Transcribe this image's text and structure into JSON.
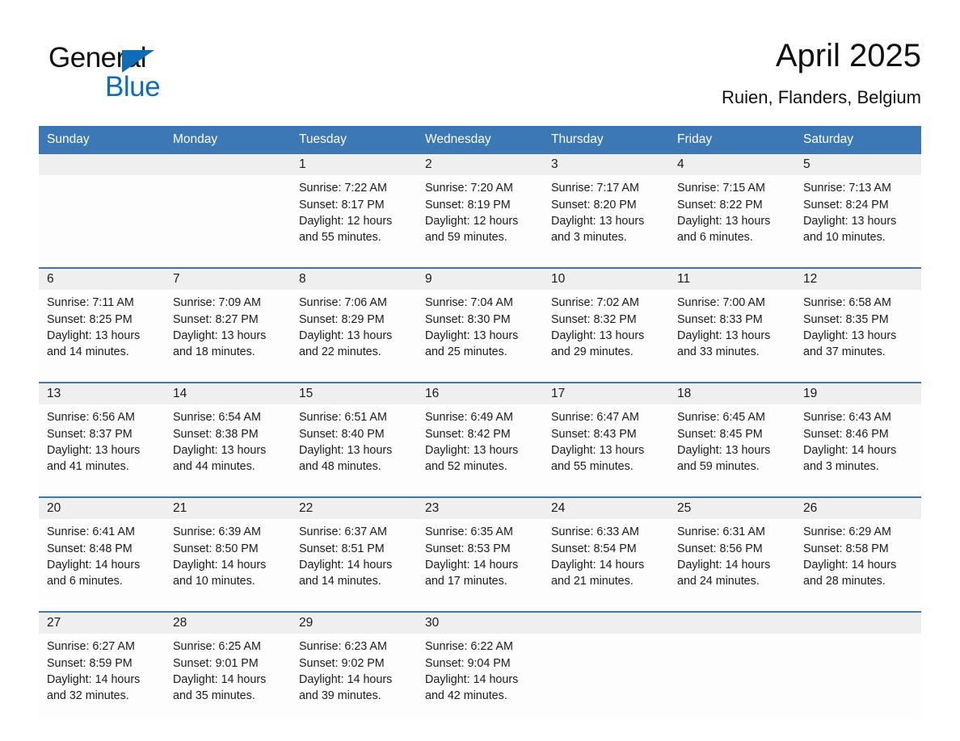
{
  "brand": {
    "name_top": "General",
    "name_bottom": "Blue",
    "triangle_icon": "brand-triangle-icon",
    "accent_color": "#0f6cb6"
  },
  "header": {
    "title": "April 2025",
    "subtitle": "Ruien, Flanders, Belgium"
  },
  "theme": {
    "header_blue": "#3c78b4",
    "date_band_gray": "#efefef",
    "cell_white": "#fdfdfd"
  },
  "weekday_headers": [
    "Sunday",
    "Monday",
    "Tuesday",
    "Wednesday",
    "Thursday",
    "Friday",
    "Saturday"
  ],
  "weeks": [
    [
      {
        "day": "",
        "sunrise": "",
        "sunset": "",
        "daylight_1": "",
        "daylight_2": ""
      },
      {
        "day": "",
        "sunrise": "",
        "sunset": "",
        "daylight_1": "",
        "daylight_2": ""
      },
      {
        "day": "1",
        "sunrise": "Sunrise: 7:22 AM",
        "sunset": "Sunset: 8:17 PM",
        "daylight_1": "Daylight: 12 hours",
        "daylight_2": "and 55 minutes."
      },
      {
        "day": "2",
        "sunrise": "Sunrise: 7:20 AM",
        "sunset": "Sunset: 8:19 PM",
        "daylight_1": "Daylight: 12 hours",
        "daylight_2": "and 59 minutes."
      },
      {
        "day": "3",
        "sunrise": "Sunrise: 7:17 AM",
        "sunset": "Sunset: 8:20 PM",
        "daylight_1": "Daylight: 13 hours",
        "daylight_2": "and 3 minutes."
      },
      {
        "day": "4",
        "sunrise": "Sunrise: 7:15 AM",
        "sunset": "Sunset: 8:22 PM",
        "daylight_1": "Daylight: 13 hours",
        "daylight_2": "and 6 minutes."
      },
      {
        "day": "5",
        "sunrise": "Sunrise: 7:13 AM",
        "sunset": "Sunset: 8:24 PM",
        "daylight_1": "Daylight: 13 hours",
        "daylight_2": "and 10 minutes."
      }
    ],
    [
      {
        "day": "6",
        "sunrise": "Sunrise: 7:11 AM",
        "sunset": "Sunset: 8:25 PM",
        "daylight_1": "Daylight: 13 hours",
        "daylight_2": "and 14 minutes."
      },
      {
        "day": "7",
        "sunrise": "Sunrise: 7:09 AM",
        "sunset": "Sunset: 8:27 PM",
        "daylight_1": "Daylight: 13 hours",
        "daylight_2": "and 18 minutes."
      },
      {
        "day": "8",
        "sunrise": "Sunrise: 7:06 AM",
        "sunset": "Sunset: 8:29 PM",
        "daylight_1": "Daylight: 13 hours",
        "daylight_2": "and 22 minutes."
      },
      {
        "day": "9",
        "sunrise": "Sunrise: 7:04 AM",
        "sunset": "Sunset: 8:30 PM",
        "daylight_1": "Daylight: 13 hours",
        "daylight_2": "and 25 minutes."
      },
      {
        "day": "10",
        "sunrise": "Sunrise: 7:02 AM",
        "sunset": "Sunset: 8:32 PM",
        "daylight_1": "Daylight: 13 hours",
        "daylight_2": "and 29 minutes."
      },
      {
        "day": "11",
        "sunrise": "Sunrise: 7:00 AM",
        "sunset": "Sunset: 8:33 PM",
        "daylight_1": "Daylight: 13 hours",
        "daylight_2": "and 33 minutes."
      },
      {
        "day": "12",
        "sunrise": "Sunrise: 6:58 AM",
        "sunset": "Sunset: 8:35 PM",
        "daylight_1": "Daylight: 13 hours",
        "daylight_2": "and 37 minutes."
      }
    ],
    [
      {
        "day": "13",
        "sunrise": "Sunrise: 6:56 AM",
        "sunset": "Sunset: 8:37 PM",
        "daylight_1": "Daylight: 13 hours",
        "daylight_2": "and 41 minutes."
      },
      {
        "day": "14",
        "sunrise": "Sunrise: 6:54 AM",
        "sunset": "Sunset: 8:38 PM",
        "daylight_1": "Daylight: 13 hours",
        "daylight_2": "and 44 minutes."
      },
      {
        "day": "15",
        "sunrise": "Sunrise: 6:51 AM",
        "sunset": "Sunset: 8:40 PM",
        "daylight_1": "Daylight: 13 hours",
        "daylight_2": "and 48 minutes."
      },
      {
        "day": "16",
        "sunrise": "Sunrise: 6:49 AM",
        "sunset": "Sunset: 8:42 PM",
        "daylight_1": "Daylight: 13 hours",
        "daylight_2": "and 52 minutes."
      },
      {
        "day": "17",
        "sunrise": "Sunrise: 6:47 AM",
        "sunset": "Sunset: 8:43 PM",
        "daylight_1": "Daylight: 13 hours",
        "daylight_2": "and 55 minutes."
      },
      {
        "day": "18",
        "sunrise": "Sunrise: 6:45 AM",
        "sunset": "Sunset: 8:45 PM",
        "daylight_1": "Daylight: 13 hours",
        "daylight_2": "and 59 minutes."
      },
      {
        "day": "19",
        "sunrise": "Sunrise: 6:43 AM",
        "sunset": "Sunset: 8:46 PM",
        "daylight_1": "Daylight: 14 hours",
        "daylight_2": "and 3 minutes."
      }
    ],
    [
      {
        "day": "20",
        "sunrise": "Sunrise: 6:41 AM",
        "sunset": "Sunset: 8:48 PM",
        "daylight_1": "Daylight: 14 hours",
        "daylight_2": "and 6 minutes."
      },
      {
        "day": "21",
        "sunrise": "Sunrise: 6:39 AM",
        "sunset": "Sunset: 8:50 PM",
        "daylight_1": "Daylight: 14 hours",
        "daylight_2": "and 10 minutes."
      },
      {
        "day": "22",
        "sunrise": "Sunrise: 6:37 AM",
        "sunset": "Sunset: 8:51 PM",
        "daylight_1": "Daylight: 14 hours",
        "daylight_2": "and 14 minutes."
      },
      {
        "day": "23",
        "sunrise": "Sunrise: 6:35 AM",
        "sunset": "Sunset: 8:53 PM",
        "daylight_1": "Daylight: 14 hours",
        "daylight_2": "and 17 minutes."
      },
      {
        "day": "24",
        "sunrise": "Sunrise: 6:33 AM",
        "sunset": "Sunset: 8:54 PM",
        "daylight_1": "Daylight: 14 hours",
        "daylight_2": "and 21 minutes."
      },
      {
        "day": "25",
        "sunrise": "Sunrise: 6:31 AM",
        "sunset": "Sunset: 8:56 PM",
        "daylight_1": "Daylight: 14 hours",
        "daylight_2": "and 24 minutes."
      },
      {
        "day": "26",
        "sunrise": "Sunrise: 6:29 AM",
        "sunset": "Sunset: 8:58 PM",
        "daylight_1": "Daylight: 14 hours",
        "daylight_2": "and 28 minutes."
      }
    ],
    [
      {
        "day": "27",
        "sunrise": "Sunrise: 6:27 AM",
        "sunset": "Sunset: 8:59 PM",
        "daylight_1": "Daylight: 14 hours",
        "daylight_2": "and 32 minutes."
      },
      {
        "day": "28",
        "sunrise": "Sunrise: 6:25 AM",
        "sunset": "Sunset: 9:01 PM",
        "daylight_1": "Daylight: 14 hours",
        "daylight_2": "and 35 minutes."
      },
      {
        "day": "29",
        "sunrise": "Sunrise: 6:23 AM",
        "sunset": "Sunset: 9:02 PM",
        "daylight_1": "Daylight: 14 hours",
        "daylight_2": "and 39 minutes."
      },
      {
        "day": "30",
        "sunrise": "Sunrise: 6:22 AM",
        "sunset": "Sunset: 9:04 PM",
        "daylight_1": "Daylight: 14 hours",
        "daylight_2": "and 42 minutes."
      },
      {
        "day": "",
        "sunrise": "",
        "sunset": "",
        "daylight_1": "",
        "daylight_2": ""
      },
      {
        "day": "",
        "sunrise": "",
        "sunset": "",
        "daylight_1": "",
        "daylight_2": ""
      },
      {
        "day": "",
        "sunrise": "",
        "sunset": "",
        "daylight_1": "",
        "daylight_2": ""
      }
    ]
  ]
}
